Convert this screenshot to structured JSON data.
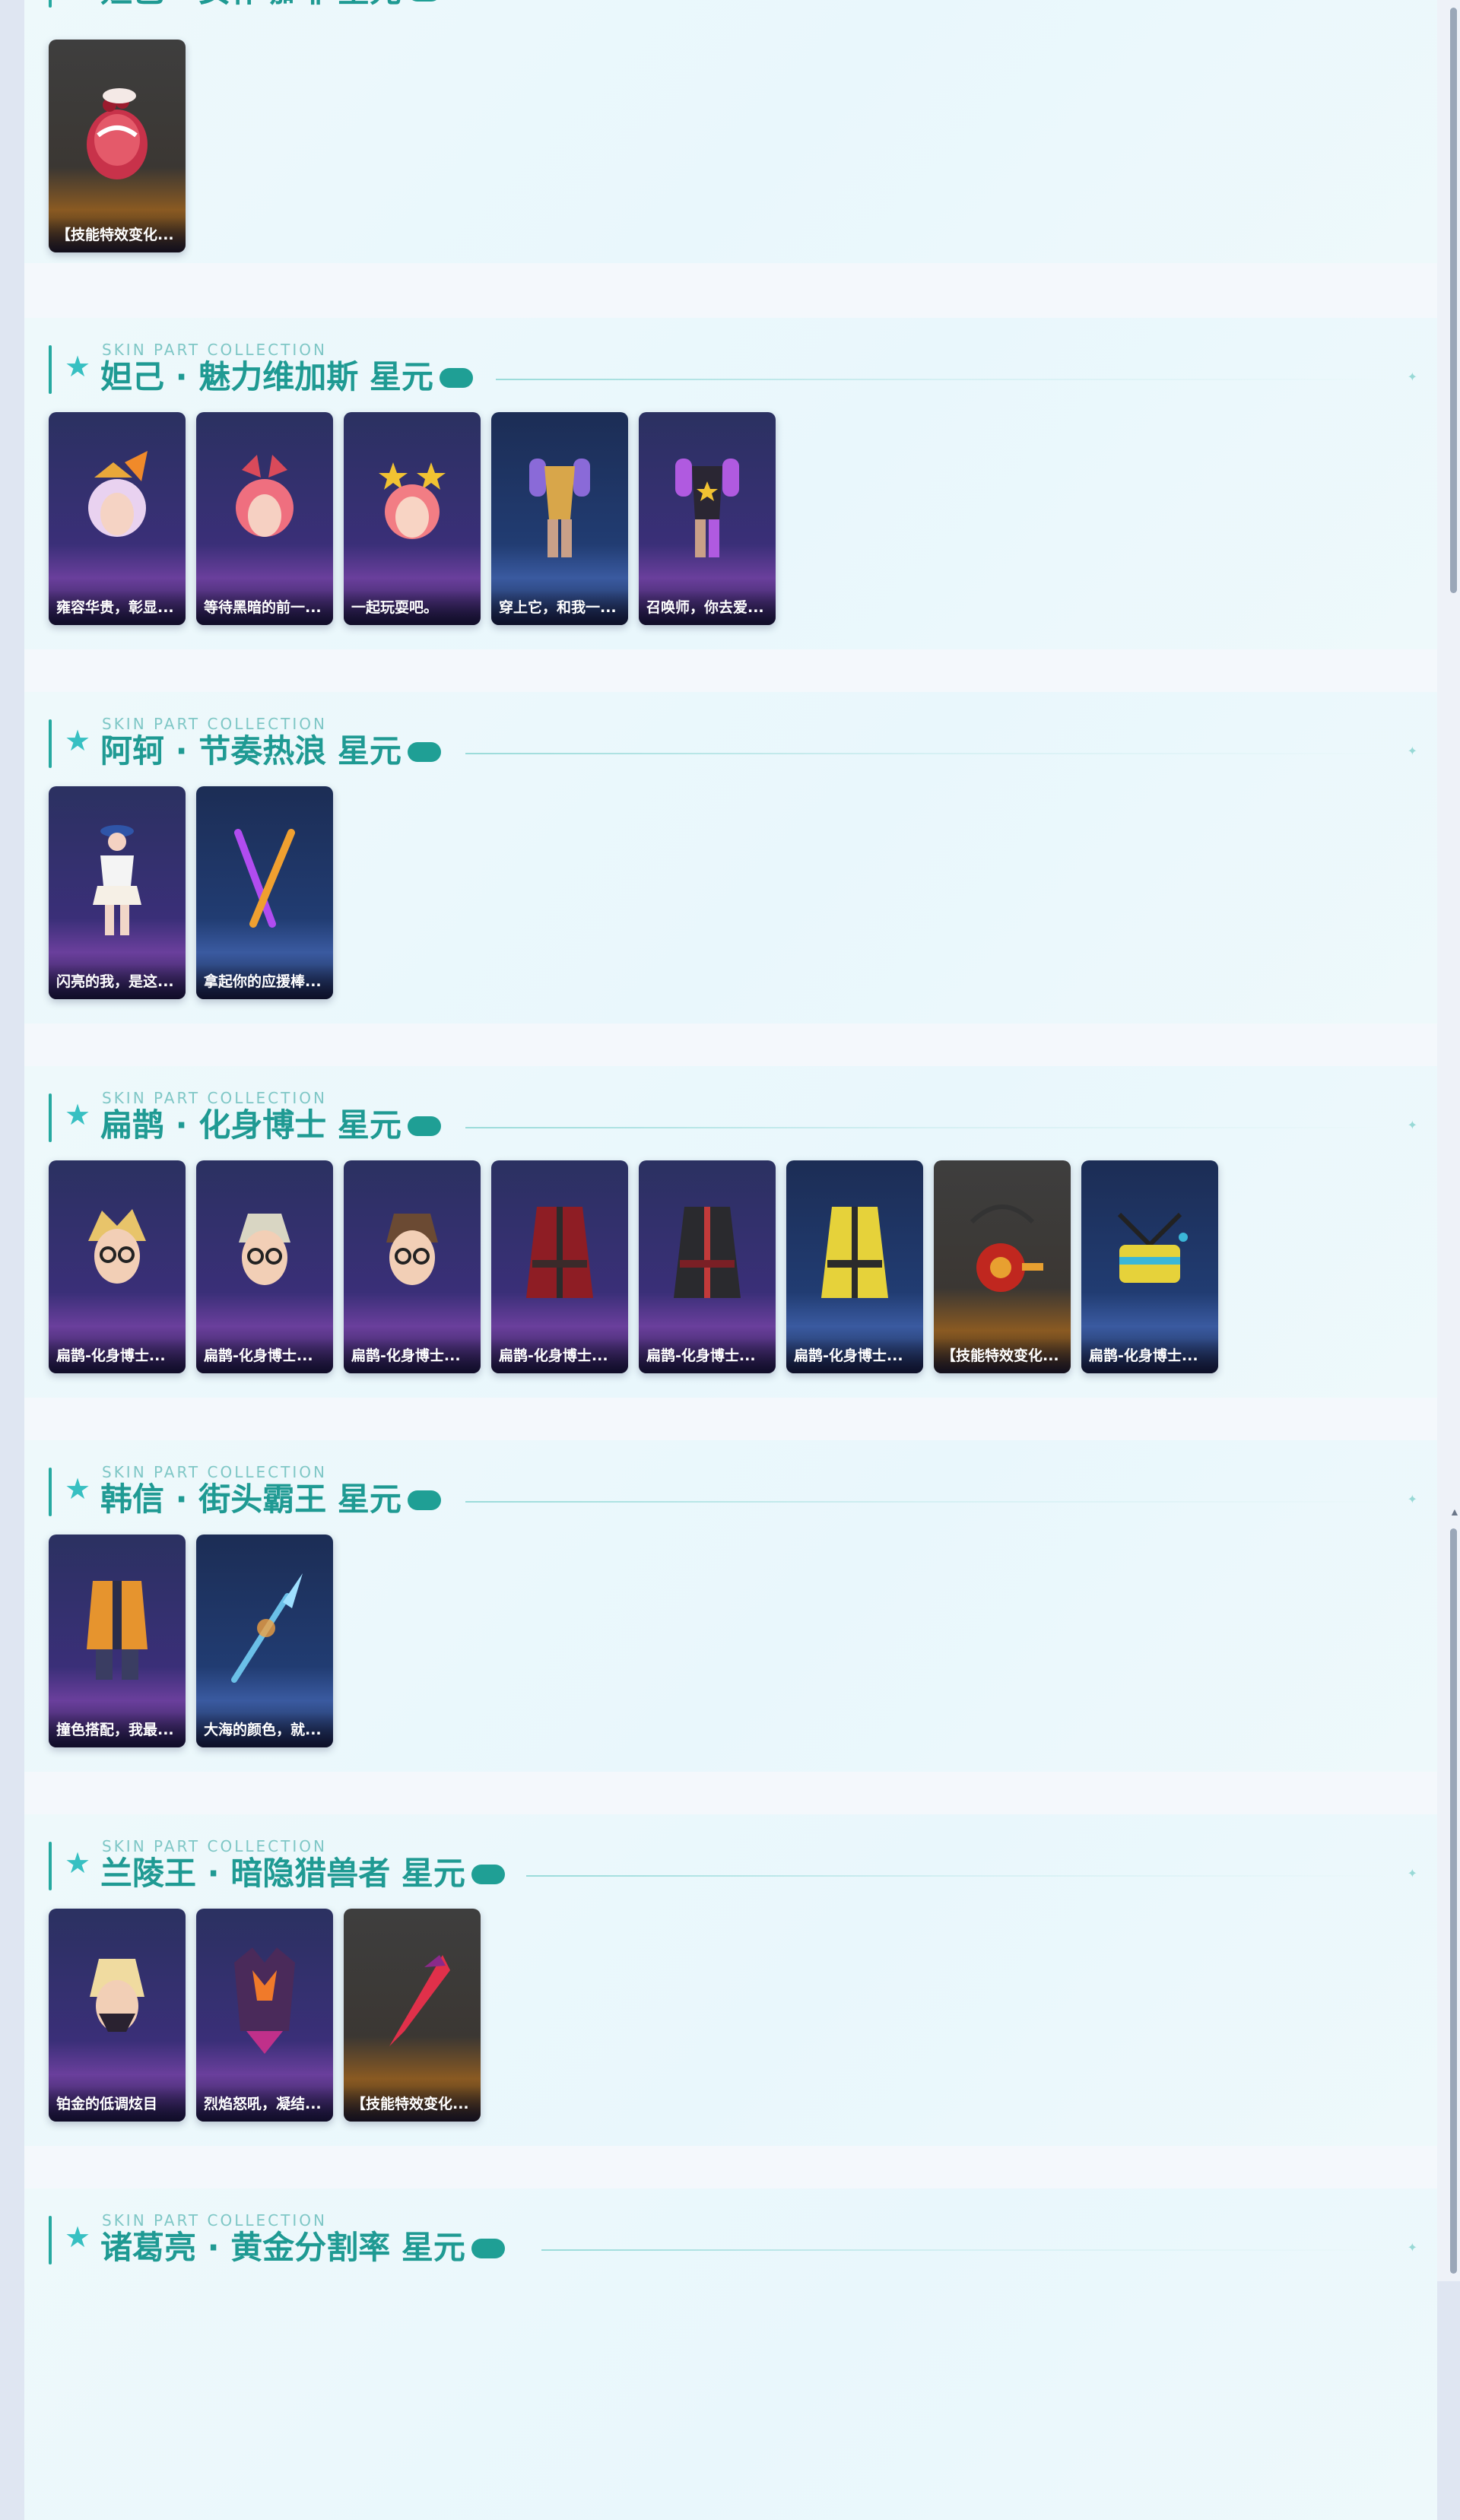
{
  "subtitle": "SKIN PART COLLECTION",
  "sections": [
    {
      "title": "妲己 · 女仆咖啡 星元",
      "cards": [
        {
          "label": "【技能特效变化...",
          "theme": "gold",
          "icon": "cake-skill-effect-icon"
        }
      ]
    },
    {
      "title": "妲己 · 魅力维加斯 星元",
      "cards": [
        {
          "label": "雍容华贵，彰显...",
          "theme": "default",
          "icon": "fox-ear-head-icon"
        },
        {
          "label": "等待黑暗的前一...",
          "theme": "default",
          "icon": "pink-hair-head-icon"
        },
        {
          "label": "一起玩耍吧。",
          "theme": "default",
          "icon": "star-hair-head-icon"
        },
        {
          "label": "穿上它，和我一...",
          "theme": "blue",
          "icon": "gold-outfit-icon"
        },
        {
          "label": "召唤师，你去爱...",
          "theme": "default",
          "icon": "black-outfit-icon"
        }
      ]
    },
    {
      "title": "阿轲 · 节奏热浪 星元",
      "cards": [
        {
          "label": "闪亮的我，是这...",
          "theme": "default",
          "icon": "cheer-outfit-icon"
        },
        {
          "label": "拿起你的应援棒...",
          "theme": "blue",
          "icon": "glow-stick-icon"
        }
      ]
    },
    {
      "title": "扁鹊 · 化身博士 星元",
      "cards": [
        {
          "label": "扁鹊-化身博士...",
          "theme": "default",
          "icon": "blonde-glasses-head-icon"
        },
        {
          "label": "扁鹊-化身博士...",
          "theme": "default",
          "icon": "silver-glasses-head-icon"
        },
        {
          "label": "扁鹊-化身博士...",
          "theme": "default",
          "icon": "brown-glasses-head-icon"
        },
        {
          "label": "扁鹊-化身博士...",
          "theme": "default",
          "icon": "red-coat-icon"
        },
        {
          "label": "扁鹊-化身博士...",
          "theme": "default",
          "icon": "black-coat-icon"
        },
        {
          "label": "扁鹊-化身博士...",
          "theme": "blue",
          "icon": "yellow-coat-icon"
        },
        {
          "label": "【技能特效变化...",
          "theme": "gold",
          "icon": "red-bag-skill-effect-icon"
        },
        {
          "label": "扁鹊-化身博士...",
          "theme": "blue",
          "icon": "yellow-bag-icon"
        }
      ]
    },
    {
      "title": "韩信 · 街头霸王 星元",
      "cards": [
        {
          "label": "撞色搭配，我最...",
          "theme": "default",
          "icon": "orange-jacket-icon"
        },
        {
          "label": "大海的颜色，就...",
          "theme": "blue",
          "icon": "blue-spear-icon"
        }
      ]
    },
    {
      "title": "兰陵王 · 暗隐猎兽者 星元",
      "cards": [
        {
          "label": "铂金的低调炫目",
          "theme": "default",
          "icon": "masked-head-icon"
        },
        {
          "label": "烈焰怒吼，凝结...",
          "theme": "default",
          "icon": "flame-armor-icon"
        },
        {
          "label": "【技能特效变化...",
          "theme": "gold",
          "icon": "red-blade-skill-effect-icon"
        }
      ]
    },
    {
      "title": "诸葛亮 · 黄金分割率 星元",
      "cards": []
    }
  ],
  "colors": {
    "accent": "#1f9a93",
    "tag": "#1f9f95",
    "star": "#37c0c2"
  }
}
